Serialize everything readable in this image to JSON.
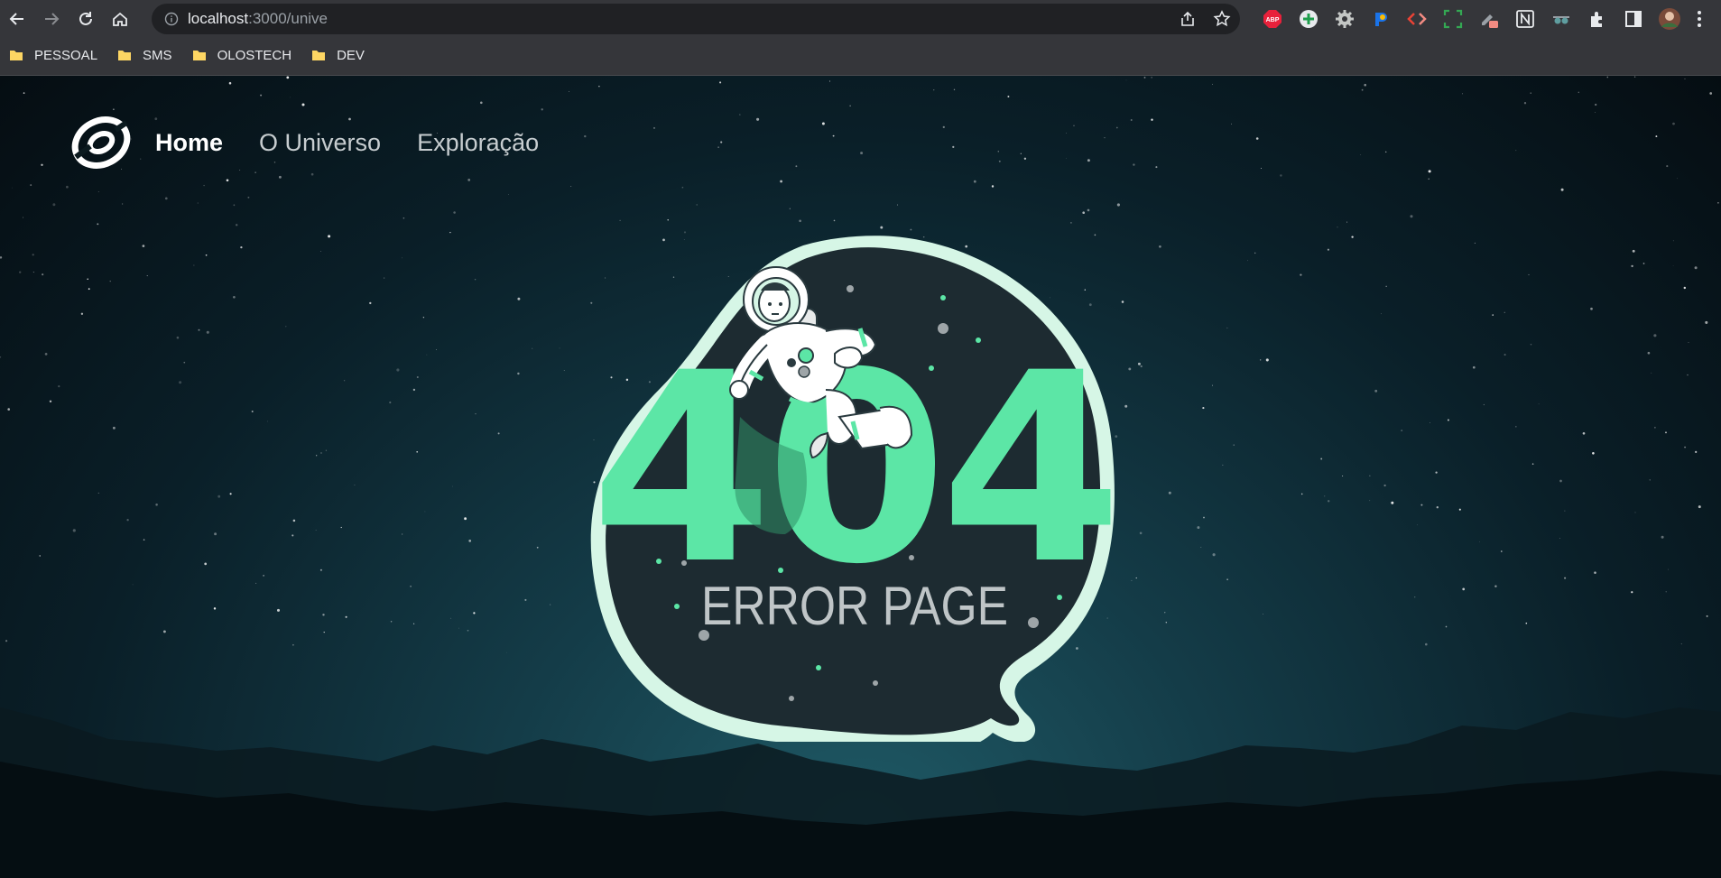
{
  "browser": {
    "url_host": "localhost",
    "url_rest": ":3000/unive",
    "bookmarks": [
      "PESSOAL",
      "SMS",
      "OLOSTECH",
      "DEV"
    ],
    "extensions": [
      "abp-icon",
      "plus-circle-icon",
      "gear-icon",
      "extension-blue-icon",
      "code-brackets-icon",
      "screen-capture-icon",
      "pen-icon",
      "notion-icon",
      "spy-icon",
      "puzzle-icon",
      "sidebar-icon",
      "profile-avatar"
    ]
  },
  "nav": {
    "items": [
      "Home",
      "O Universo",
      "Exploração"
    ]
  },
  "hero": {
    "number": "404",
    "caption": "ERROR PAGE"
  },
  "colors": {
    "accent": "#5ce6a6",
    "blob_outline": "#d6f6e6",
    "blob_fill": "#1d2b31",
    "caption": "#bfc5c7"
  }
}
